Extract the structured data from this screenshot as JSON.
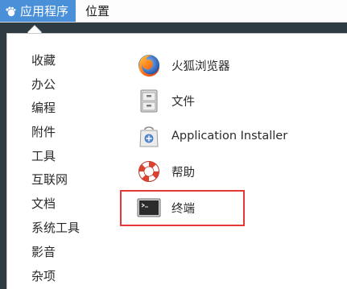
{
  "topbar": {
    "applications_label": "应用程序",
    "places_label": "位置"
  },
  "categories": [
    {
      "label": "收藏"
    },
    {
      "label": "办公"
    },
    {
      "label": "编程"
    },
    {
      "label": "附件"
    },
    {
      "label": "工具"
    },
    {
      "label": "互联网"
    },
    {
      "label": "文档"
    },
    {
      "label": "系统工具"
    },
    {
      "label": "影音"
    },
    {
      "label": "杂项"
    }
  ],
  "apps": [
    {
      "label": "火狐浏览器",
      "icon": "firefox-icon"
    },
    {
      "label": "文件",
      "icon": "file-cabinet-icon"
    },
    {
      "label": "Application Installer",
      "icon": "software-bag-icon"
    },
    {
      "label": "帮助",
      "icon": "lifebuoy-icon"
    },
    {
      "label": "终端",
      "icon": "terminal-icon"
    }
  ],
  "colors": {
    "accent": "#4a90d9",
    "highlight": "#e53935",
    "desktop": "#2e3b43"
  }
}
